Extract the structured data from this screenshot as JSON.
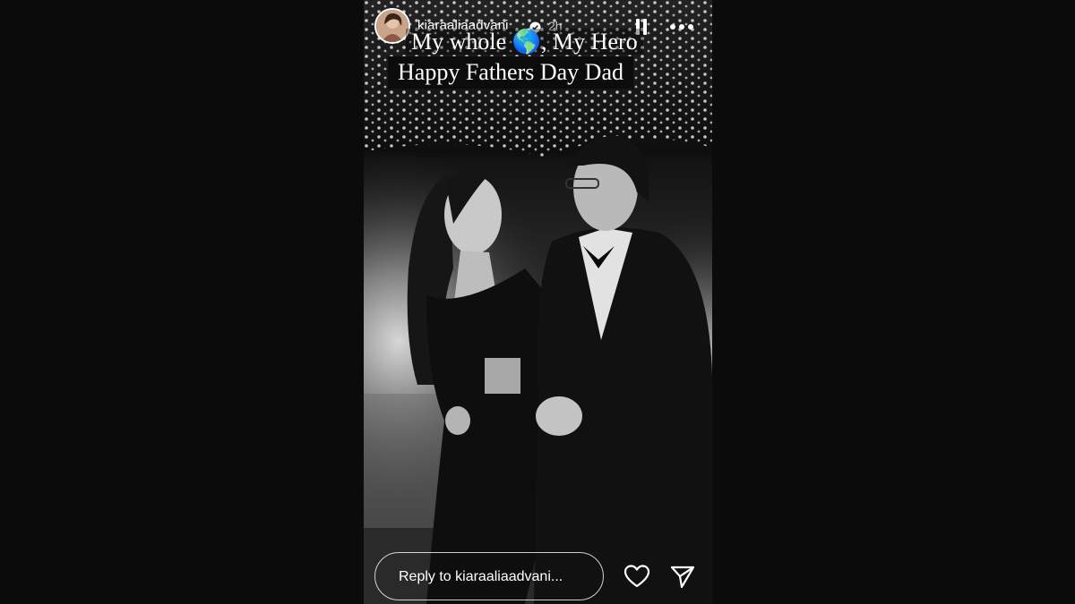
{
  "story": {
    "username": "kiaraaliaadvani",
    "time": "2h",
    "caption_line1": "My whole 🌎, My Hero",
    "caption_line2": "Happy Fathers Day Dad",
    "reply_placeholder": "Reply to kiaraaliaadvani..."
  },
  "icons": {
    "verified": "verified-badge-icon",
    "pause": "pause-icon",
    "more": "more-options-icon",
    "like": "heart-icon",
    "share": "send-icon"
  },
  "colors": {
    "background": "#0b0b0b",
    "verified": "#ffffff",
    "text": "#ffffff"
  }
}
